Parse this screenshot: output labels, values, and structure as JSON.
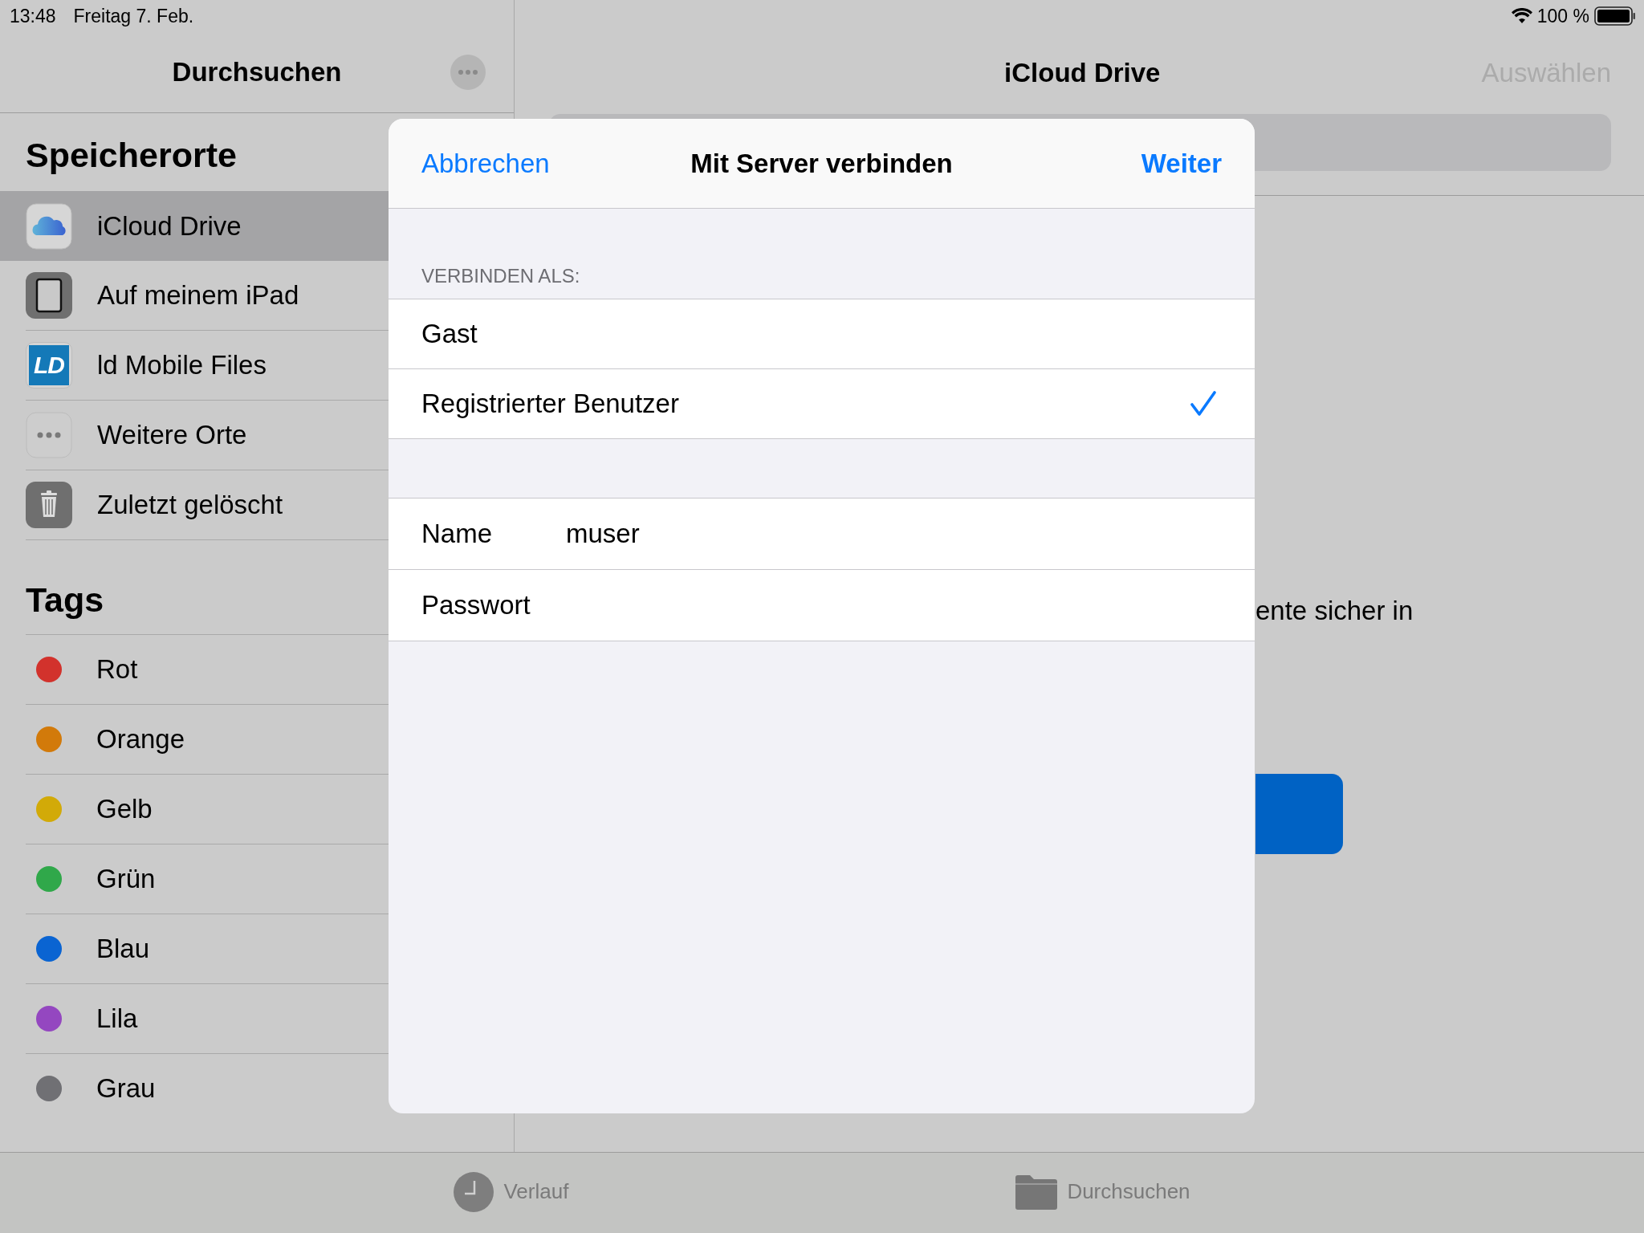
{
  "status_bar": {
    "time": "13:48",
    "date": "Freitag 7. Feb.",
    "battery": "100 %"
  },
  "sidebar": {
    "title": "Durchsuchen",
    "locations": {
      "heading": "Speicherorte",
      "items": [
        {
          "label": "iCloud Drive",
          "kind": "icloud",
          "selected": true
        },
        {
          "label": "Auf meinem iPad",
          "kind": "ipad",
          "selected": false
        },
        {
          "label": "ld Mobile Files",
          "kind": "ld",
          "icon_text": "LD",
          "selected": false
        },
        {
          "label": "Weitere Orte",
          "kind": "more",
          "selected": false
        },
        {
          "label": "Zuletzt gelöscht",
          "kind": "trash",
          "selected": false
        }
      ]
    },
    "tags": {
      "heading": "Tags",
      "items": [
        {
          "label": "Rot",
          "color": "#d2322c"
        },
        {
          "label": "Orange",
          "color": "#d27a0a"
        },
        {
          "label": "Gelb",
          "color": "#d2aa08"
        },
        {
          "label": "Grün",
          "color": "#30a84a"
        },
        {
          "label": "Blau",
          "color": "#0a64d2"
        },
        {
          "label": "Lila",
          "color": "#9447c0"
        },
        {
          "label": "Grau",
          "color": "#707074"
        }
      ]
    }
  },
  "main": {
    "title": "iCloud Drive",
    "select_button": "Auswählen",
    "partial_text": "ente sicher in"
  },
  "dialog": {
    "cancel": "Abbrechen",
    "title": "Mit Server verbinden",
    "next": "Weiter",
    "section_header": "VERBINDEN ALS:",
    "options": [
      {
        "label": "Gast",
        "selected": false
      },
      {
        "label": "Registrierter Benutzer",
        "selected": true
      }
    ],
    "fields": [
      {
        "label": "Name",
        "value": "muser"
      },
      {
        "label": "Passwort"
      }
    ]
  },
  "tab_bar": [
    {
      "label": "Verlauf",
      "kind": "clock"
    },
    {
      "label": "Durchsuchen",
      "kind": "folder"
    }
  ]
}
